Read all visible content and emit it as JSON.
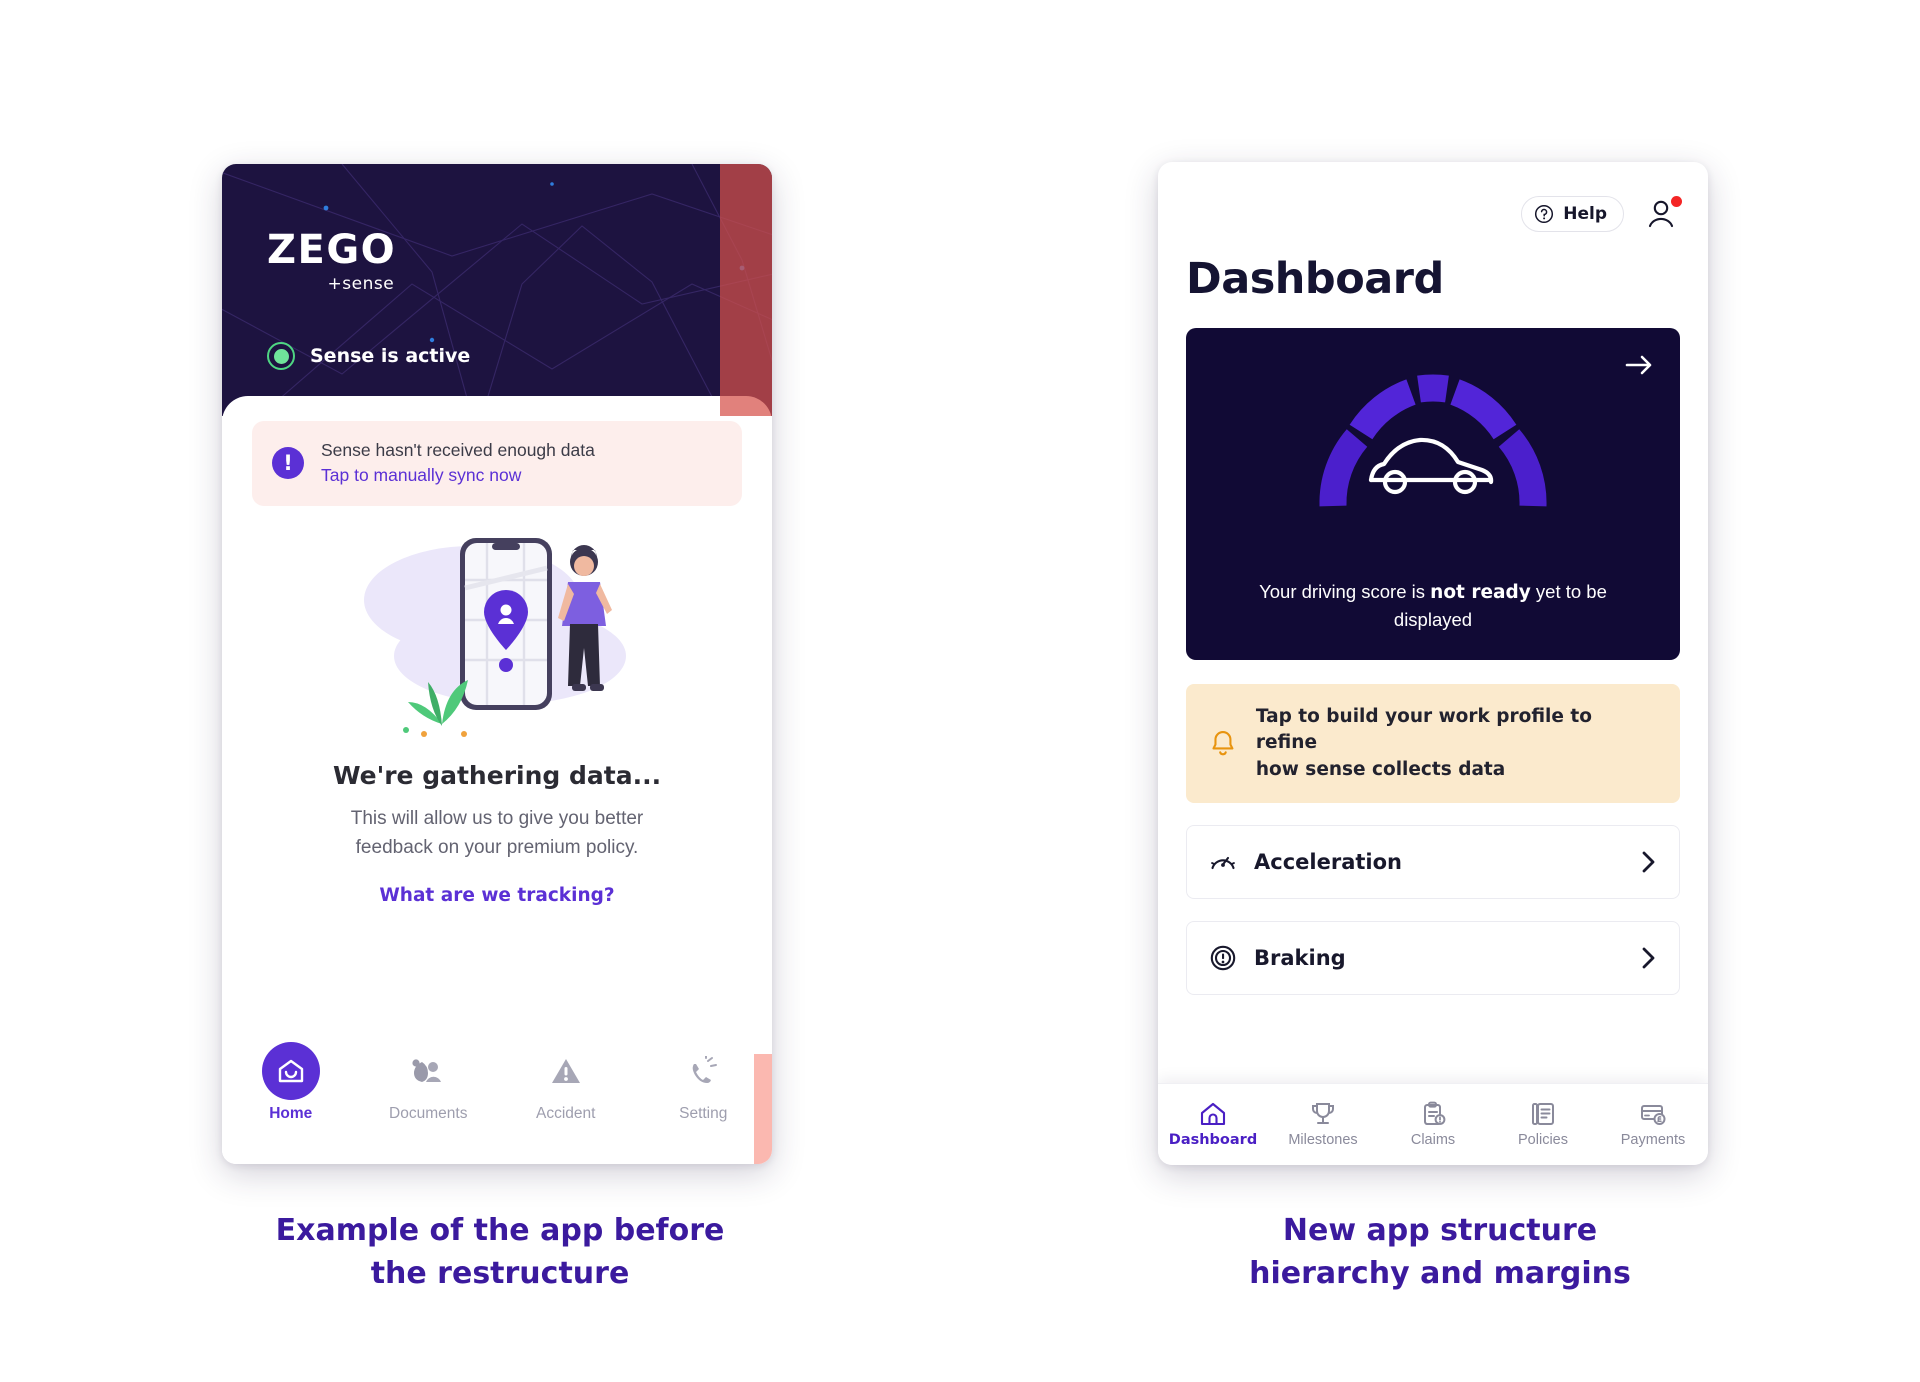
{
  "colors": {
    "brand_purple": "#5b30d5",
    "caption_purple": "#3b1a9e",
    "hero_navy": "#1d1340",
    "card_navy": "#110a35",
    "alert_pink_bg": "#fdeeec",
    "amber_bg": "#fbeacd",
    "amber_icon": "#e8940f",
    "status_green": "#6fe39a",
    "badge_red": "#f42525",
    "coral_overlay": "#d6504a"
  },
  "left_phone": {
    "hero": {
      "logo_main": "ZEGO",
      "logo_sub": "+sense",
      "status_label": "Sense is active",
      "status_indicator_icon": "green-dot-icon"
    },
    "alert": {
      "icon": "exclamation-circle-icon",
      "line1": "Sense hasn't received enough data",
      "line2": "Tap to manually sync now"
    },
    "illustration_icon": "phone-map-location-person-illustration",
    "gathering": {
      "title": "We're gathering data...",
      "body_line1": "This will allow us to give you better",
      "body_line2": "feedback on your premium policy.",
      "link": "What are we tracking?"
    },
    "tabs": [
      {
        "label": "Home",
        "icon": "home-smile-icon",
        "active": true
      },
      {
        "label": "Documents",
        "icon": "documents-people-icon",
        "active": false
      },
      {
        "label": "Accident",
        "icon": "warning-triangle-icon",
        "active": false
      },
      {
        "label": "Setting",
        "icon": "phone-ringing-icon",
        "active": false
      }
    ]
  },
  "right_phone": {
    "header": {
      "help_label": "Help",
      "help_icon": "question-circle-icon",
      "avatar_icon": "person-icon",
      "avatar_badge": true
    },
    "page_title": "Dashboard",
    "score_card": {
      "arrow_icon": "arrow-right-icon",
      "gauge_icon": "car-gauge-icon",
      "text_before": "Your driving score is ",
      "text_bold": "not ready",
      "text_after": " yet to be displayed"
    },
    "notice": {
      "icon": "bell-icon",
      "line1": "Tap to build your work profile to refine",
      "line2": "how sense collects data"
    },
    "metrics": [
      {
        "label": "Acceleration",
        "icon": "speedometer-icon",
        "chevron": "chevron-right-icon"
      },
      {
        "label": "Braking",
        "icon": "brake-disc-icon",
        "chevron": "chevron-right-icon"
      }
    ],
    "tabs": [
      {
        "label": "Dashboard",
        "icon": "home-icon",
        "active": true
      },
      {
        "label": "Milestones",
        "icon": "trophy-icon",
        "active": false
      },
      {
        "label": "Claims",
        "icon": "clipboard-alert-icon",
        "active": false
      },
      {
        "label": "Policies",
        "icon": "documents-icon",
        "active": false
      },
      {
        "label": "Payments",
        "icon": "card-pound-icon",
        "active": false
      }
    ]
  },
  "captions": {
    "left_line1": "Example of the app before",
    "left_line2": "the restructure",
    "right_line1": "New app structure",
    "right_line2": "hierarchy and margins"
  }
}
